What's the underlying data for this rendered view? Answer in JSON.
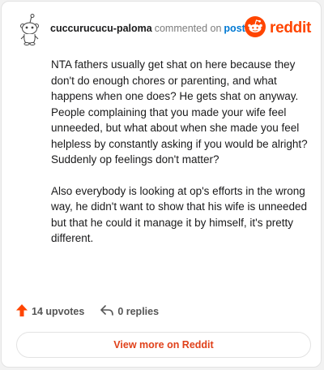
{
  "header": {
    "username": "cuccurucucu-paloma",
    "action_text": "commented on",
    "post_link": "post",
    "brand_name": "reddit"
  },
  "comment": {
    "paragraphs": [
      "NTA fathers usually get shat on here because they don't do enough chores or parenting, and what happens when one does? He gets shat on anyway. People complaining that you made your wife feel unneeded, but what about when she made you feel helpless by constantly asking if you would be alright? Suddenly op feelings don't matter?",
      "Also everybody is looking at op's efforts in the wrong way, he didn't want to show that his wife is unneeded but that he could it manage it by himself, it's pretty different."
    ]
  },
  "footer": {
    "upvotes_label": "14 upvotes",
    "replies_label": "0 replies",
    "view_button_label": "View more on Reddit"
  },
  "colors": {
    "brand_orange": "#ff4500",
    "link_blue": "#0079d3",
    "upvote_orange": "#ff4500"
  },
  "icons": {
    "avatar": "snoo-avatar-icon",
    "brand": "reddit-logo-icon",
    "upvote": "upvote-arrow-icon",
    "reply": "reply-arrow-icon"
  }
}
